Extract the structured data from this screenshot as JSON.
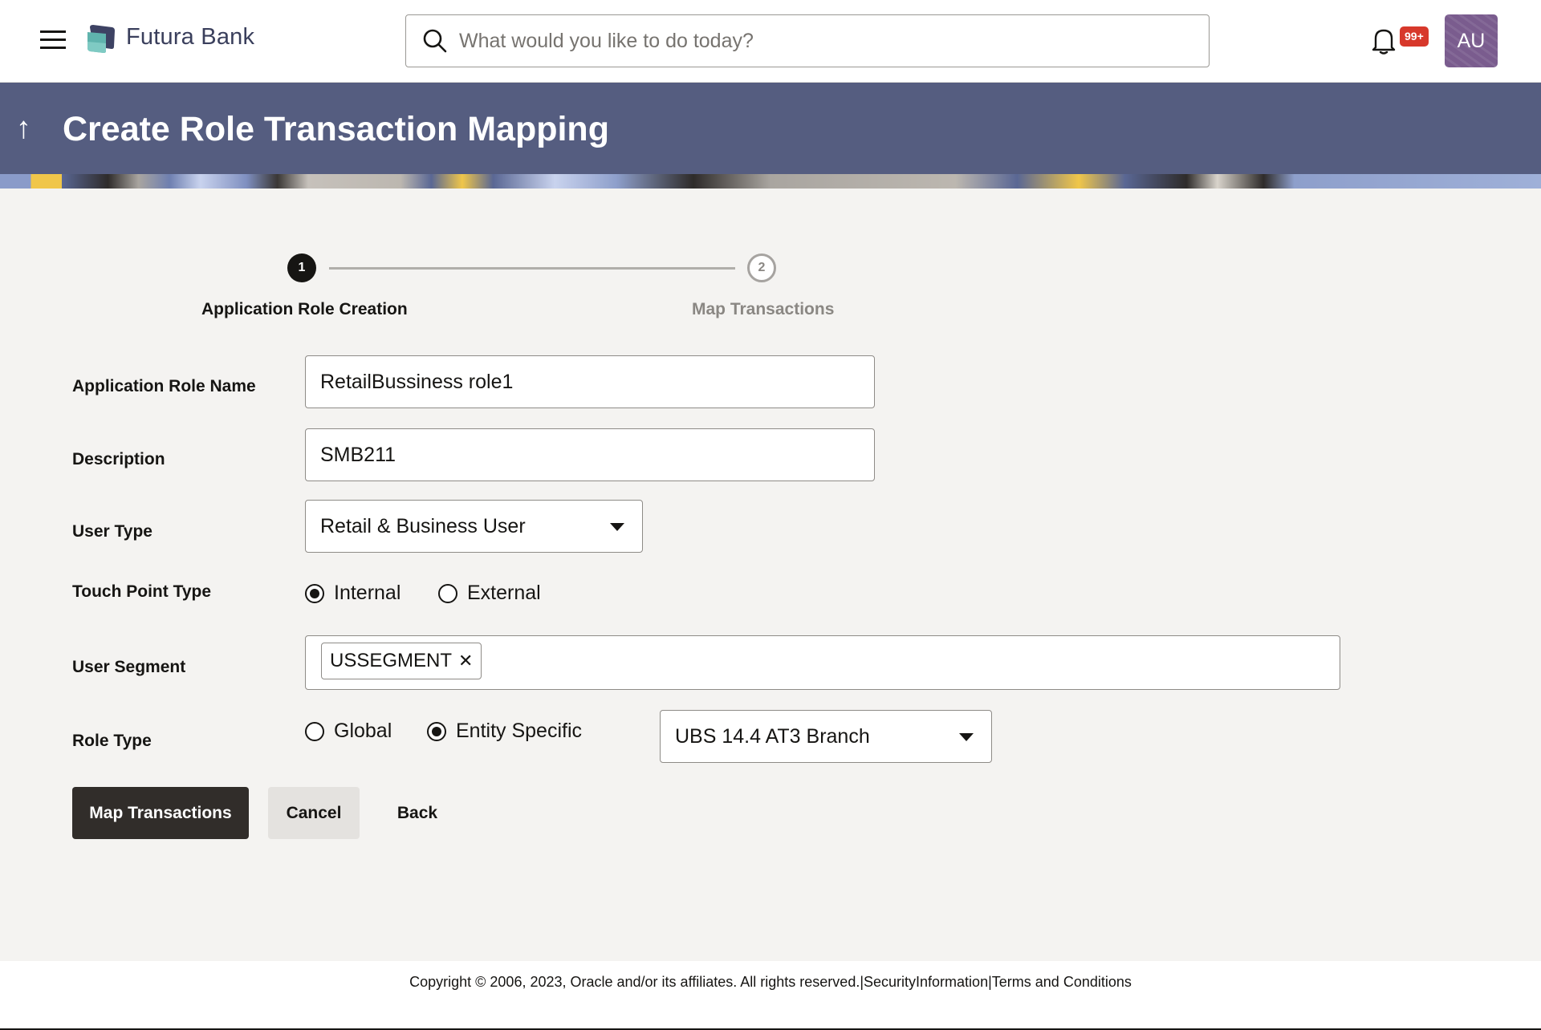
{
  "header": {
    "brand": "Futura Bank",
    "search_placeholder": "What would you like to do today?",
    "notification_badge": "99+",
    "avatar_initials": "AU"
  },
  "banner": {
    "title": "Create Role Transaction Mapping",
    "back_icon": "arrow-up-icon"
  },
  "stepper": {
    "current_step": 1,
    "steps": [
      {
        "number": "1",
        "label": "Application Role Creation",
        "state": "active"
      },
      {
        "number": "2",
        "label": "Map Transactions",
        "state": "pending"
      }
    ]
  },
  "form": {
    "role_name": {
      "label": "Application Role Name",
      "value": "RetailBussiness role1"
    },
    "description": {
      "label": "Description",
      "value": "SMB211"
    },
    "user_type": {
      "label": "User Type",
      "selected": "Retail & Business User"
    },
    "touch_point": {
      "label": "Touch Point Type",
      "options": [
        {
          "label": "Internal",
          "checked": true
        },
        {
          "label": "External",
          "checked": false
        }
      ]
    },
    "user_segment": {
      "label": "User Segment",
      "chips": [
        "USSEGMENT"
      ]
    },
    "role_type": {
      "label": "Role Type",
      "options": [
        {
          "label": "Global",
          "checked": false
        },
        {
          "label": "Entity Specific",
          "checked": true
        }
      ],
      "entity_selected": "UBS 14.4 AT3 Branch"
    }
  },
  "actions": {
    "primary": "Map Transactions",
    "cancel": "Cancel",
    "back": "Back"
  },
  "footer": {
    "copyright": "Copyright © 2006, 2023, Oracle and/or its affiliates. All rights reserved.",
    "separator": "|",
    "security_link": "SecurityInformation",
    "terms_link": "Terms and Conditions"
  },
  "colors": {
    "banner": "#555d80",
    "primary_button": "#312d2a",
    "badge": "#d7382b",
    "avatar": "#7a5c8e",
    "brand_text": "#3a3f5c"
  }
}
